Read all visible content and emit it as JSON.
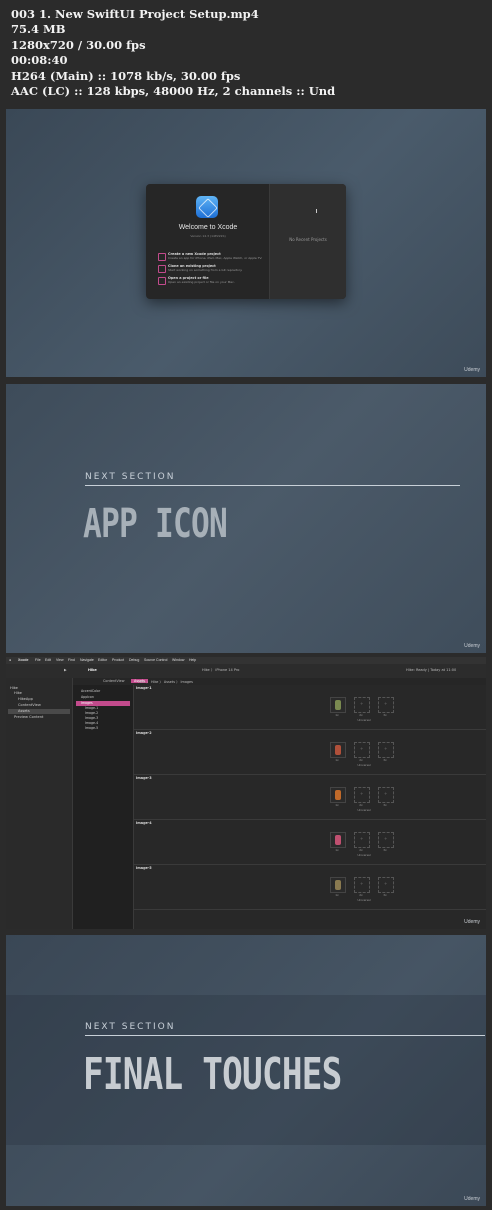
{
  "file_info": {
    "lines": [
      "003 1. New SwiftUI Project Setup.mp4",
      "75.4 MB",
      "1280x720 / 30.00 fps",
      "00:08:40",
      "H264 (Main) :: 1078 kb/s, 30.00 fps",
      "AAC (LC) :: 128 kbps, 48000 Hz, 2 channels :: Und"
    ]
  },
  "watermark": "Udemy",
  "frame1": {
    "welcome_title": "Welcome to Xcode",
    "version": "Version 14.3 (14E222b)",
    "options": [
      {
        "title": "Create a new Xcode project",
        "desc": "Create an app for iPhone, iPad, Mac, Apple Watch, or Apple TV."
      },
      {
        "title": "Clone an existing project",
        "desc": "Start working on something from a Git repository."
      },
      {
        "title": "Open a project or file",
        "desc": "Open an existing project or file on your Mac."
      }
    ],
    "no_recent": "No Recent Projects"
  },
  "frame2": {
    "label": "NEXT SECTION",
    "title": "APP ICON"
  },
  "frame3": {
    "menu": [
      "Xcode",
      "File",
      "Edit",
      "View",
      "Find",
      "Navigate",
      "Editor",
      "Product",
      "Debug",
      "Source Control",
      "Window",
      "Help"
    ],
    "project_name": "Hike",
    "tab_content": "ContentView",
    "tab_assets": "Assets",
    "scheme": "Hike  〉  iPhone 14 Pro",
    "status": "Hike: Ready | Today at 11:00",
    "breadcrumb": "Hike 〉 Hike 〉 Assets 〉 Images",
    "navigator": [
      "Hike",
      "Hike",
      "HikeApp",
      "ContentView",
      "Assets",
      "Preview Content"
    ],
    "asset_list": [
      "AccentColor",
      "AppIcon",
      "Images",
      "Image-1",
      "Image-2",
      "Image-3",
      "Image-4",
      "Image-5"
    ],
    "image_sets": [
      "Image-1",
      "Image-2",
      "Image-3",
      "Image-4",
      "Image-5"
    ],
    "scale_labels": [
      "1x",
      "2x",
      "3x"
    ],
    "universal": "Universal",
    "sprite_colors": [
      "#7a8a50",
      "#b0503a",
      "#c06a2a",
      "#c05070",
      "#8a7a50"
    ]
  },
  "frame4": {
    "label": "NEXT SECTION",
    "title": "FINAL TOUCHES"
  }
}
